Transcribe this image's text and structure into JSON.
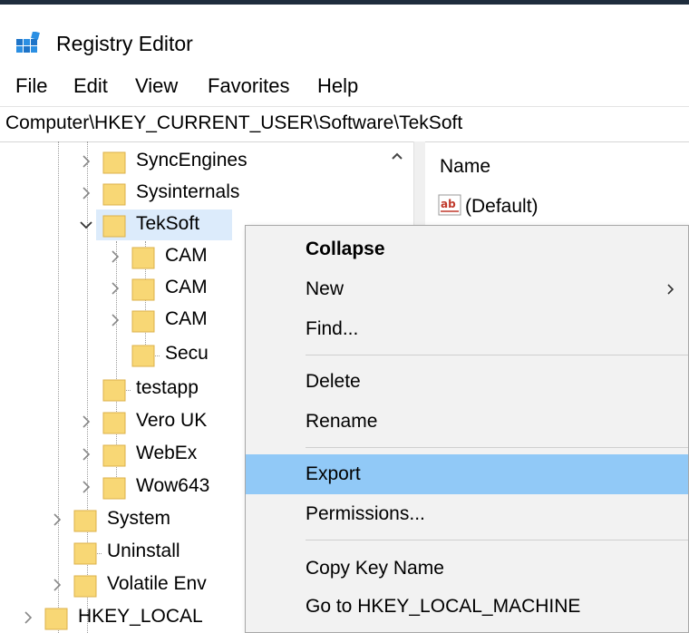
{
  "window": {
    "title": "Registry Editor"
  },
  "menu": [
    "File",
    "Edit",
    "View",
    "Favorites",
    "Help"
  ],
  "address": "Computer\\HKEY_CURRENT_USER\\Software\\TekSoft",
  "tree": {
    "items": [
      {
        "label": "SyncEngines",
        "state": "collapsed"
      },
      {
        "label": "Sysinternals",
        "state": "collapsed"
      },
      {
        "label": "TekSoft",
        "state": "expanded"
      },
      {
        "label": "CAM",
        "state": "collapsed"
      },
      {
        "label": "CAM",
        "state": "collapsed"
      },
      {
        "label": "CAM",
        "state": "collapsed"
      },
      {
        "label": "Secu",
        "state": "leaf"
      },
      {
        "label": "testapp",
        "state": "leaf"
      },
      {
        "label": "Vero UK",
        "state": "collapsed"
      },
      {
        "label": "WebEx",
        "state": "collapsed"
      },
      {
        "label": "Wow643",
        "state": "collapsed"
      },
      {
        "label": "System",
        "state": "collapsed"
      },
      {
        "label": "Uninstall",
        "state": "leaf"
      },
      {
        "label": "Volatile Env",
        "state": "collapsed"
      },
      {
        "label": "HKEY_LOCAL",
        "state": "collapsed"
      }
    ]
  },
  "values_pane": {
    "column_name": "Name",
    "rows": [
      {
        "name": "(Default)",
        "icon": "string-value-icon"
      }
    ]
  },
  "context_menu": {
    "items": [
      {
        "label": "Collapse"
      },
      {
        "label": "New"
      },
      {
        "label": "Find..."
      },
      {
        "label": "Delete"
      },
      {
        "label": "Rename"
      },
      {
        "label": "Export"
      },
      {
        "label": "Permissions..."
      },
      {
        "label": "Copy Key Name"
      },
      {
        "label": "Go to HKEY_LOCAL_MACHINE"
      }
    ],
    "highlighted": "Export"
  },
  "colors": {
    "selection": "#dcebfb",
    "menu_highlight": "#91c9f7",
    "folder": "#f8d775",
    "folder_border": "#dcb24a"
  }
}
